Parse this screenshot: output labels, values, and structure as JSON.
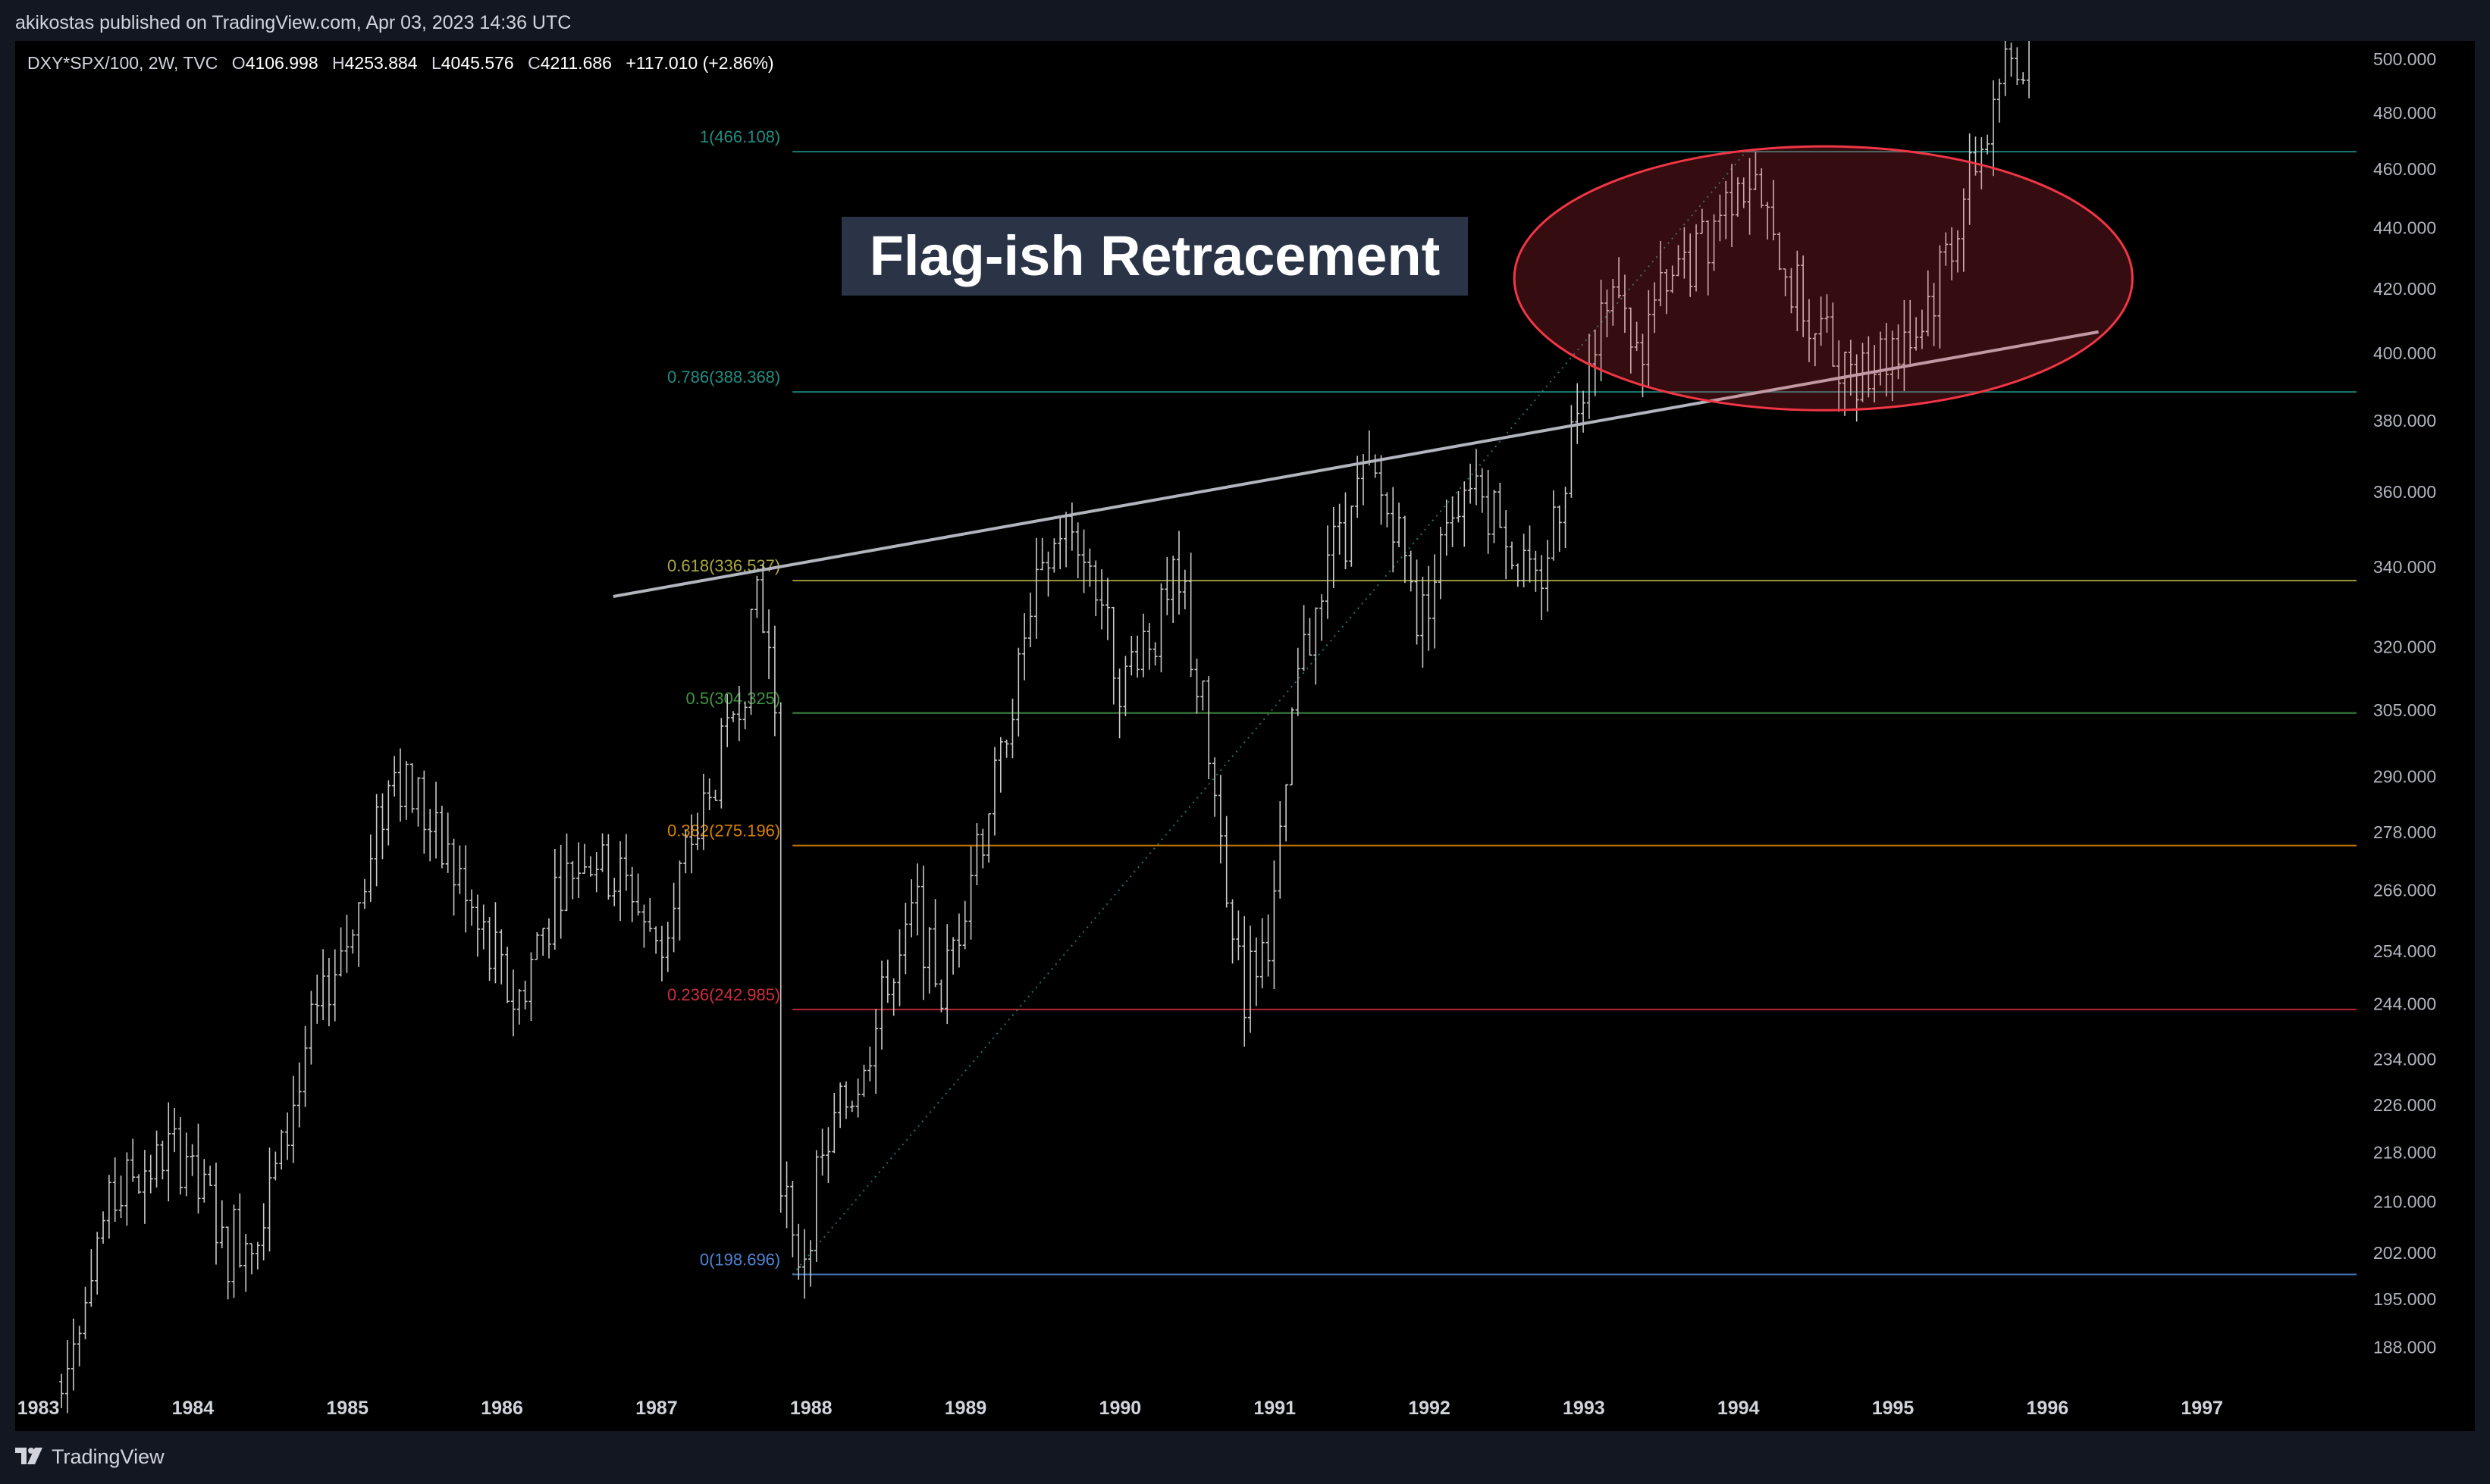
{
  "header": {
    "published_text": "akikostas published on TradingView.com, Apr 03, 2023 14:36 UTC"
  },
  "legend": {
    "symbol": "DXY*SPX/100, 2W, TVC",
    "open_label": "O",
    "open": "4106.998",
    "high_label": "H",
    "high": "4253.884",
    "low_label": "L",
    "low": "4045.576",
    "close_label": "C",
    "close": "4211.686",
    "change": "+117.010 (+2.86%)"
  },
  "annotation": {
    "text": "Flag-ish Retracement",
    "ellipse_color": "#f23645"
  },
  "footer": {
    "brand": "TradingView"
  },
  "chart_data": {
    "type": "ohlc",
    "interval": "2W",
    "y_scale": "log",
    "ylim": [
      182,
      507
    ],
    "xlim": [
      1982.85,
      1998.0
    ],
    "x_ticks": [
      "1983",
      "1984",
      "1985",
      "1986",
      "1987",
      "1988",
      "1989",
      "1990",
      "1991",
      "1992",
      "1993",
      "1994",
      "1995",
      "1996",
      "1997"
    ],
    "y_ticks": [
      "188.000",
      "195.000",
      "202.000",
      "210.000",
      "218.000",
      "226.000",
      "234.000",
      "244.000",
      "254.000",
      "266.000",
      "278.000",
      "290.000",
      "305.000",
      "320.000",
      "340.000",
      "360.000",
      "380.000",
      "400.000",
      "420.000",
      "440.000",
      "460.000",
      "480.000",
      "500.000"
    ],
    "price_path": [
      [
        1983.15,
        183
      ],
      [
        1983.3,
        197
      ],
      [
        1983.5,
        212
      ],
      [
        1983.75,
        216
      ],
      [
        1983.95,
        218
      ],
      [
        1984.2,
        203
      ],
      [
        1984.45,
        208
      ],
      [
        1984.7,
        232
      ],
      [
        1984.95,
        252
      ],
      [
        1985.15,
        272
      ],
      [
        1985.3,
        295
      ],
      [
        1985.5,
        282
      ],
      [
        1985.75,
        266
      ],
      [
        1985.95,
        252
      ],
      [
        1986.1,
        244
      ],
      [
        1986.3,
        262
      ],
      [
        1986.55,
        275
      ],
      [
        1986.8,
        268
      ],
      [
        1987.0,
        255
      ],
      [
        1987.2,
        272
      ],
      [
        1987.4,
        292
      ],
      [
        1987.55,
        310
      ],
      [
        1987.65,
        335
      ],
      [
        1987.72,
        320
      ],
      [
        1987.78,
        300
      ],
      [
        1987.8,
        218
      ],
      [
        1987.9,
        198.7
      ],
      [
        1988.1,
        218
      ],
      [
        1988.3,
        232
      ],
      [
        1988.5,
        248
      ],
      [
        1988.7,
        262
      ],
      [
        1988.85,
        244
      ],
      [
        1989.0,
        268
      ],
      [
        1989.2,
        290
      ],
      [
        1989.4,
        325
      ],
      [
        1989.6,
        350
      ],
      [
        1989.75,
        345
      ],
      [
        1989.9,
        330
      ],
      [
        1990.0,
        312
      ],
      [
        1990.15,
        322
      ],
      [
        1990.4,
        335
      ],
      [
        1990.55,
        300
      ],
      [
        1990.7,
        262
      ],
      [
        1990.8,
        248
      ],
      [
        1991.0,
        262
      ],
      [
        1991.15,
        312
      ],
      [
        1991.35,
        345
      ],
      [
        1991.6,
        362
      ],
      [
        1991.8,
        352
      ],
      [
        1991.95,
        325
      ],
      [
        1992.1,
        352
      ],
      [
        1992.3,
        365
      ],
      [
        1992.5,
        350
      ],
      [
        1992.7,
        330
      ],
      [
        1992.85,
        362
      ],
      [
        1993.0,
        395
      ],
      [
        1993.15,
        420
      ],
      [
        1993.35,
        402
      ],
      [
        1993.55,
        420
      ],
      [
        1993.8,
        438
      ],
      [
        1994.0,
        462
      ],
      [
        1994.15,
        445
      ],
      [
        1994.35,
        420
      ],
      [
        1994.55,
        405
      ],
      [
        1994.75,
        395
      ],
      [
        1994.95,
        402
      ],
      [
        1995.15,
        408
      ],
      [
        1995.3,
        425
      ],
      [
        1995.45,
        450
      ],
      [
        1995.6,
        472
      ],
      [
        1995.75,
        498
      ],
      [
        1995.9,
        504
      ]
    ],
    "fibonacci": [
      {
        "level": "1",
        "value": 466.108,
        "label": "1(466.108)",
        "color": "#26a69a"
      },
      {
        "level": "0.786",
        "value": 388.368,
        "label": "0.786(388.368)",
        "color": "#26a69a"
      },
      {
        "level": "0.618",
        "value": 336.537,
        "label": "0.618(336.537)",
        "color": "#c9c54a"
      },
      {
        "level": "0.5",
        "value": 304.325,
        "label": "0.5(304.325)",
        "color": "#4caf50"
      },
      {
        "level": "0.382",
        "value": 275.196,
        "label": "0.382(275.196)",
        "color": "#ff9800"
      },
      {
        "level": "0.236",
        "value": 242.985,
        "label": "0.236(242.985)",
        "color": "#f23645"
      },
      {
        "level": "0",
        "value": 198.696,
        "label": "0(198.696)",
        "color": "#5b9cf6"
      }
    ],
    "fib_start": {
      "x": 1987.88,
      "value": 198.696
    },
    "fib_end": {
      "x": 1994.05,
      "value": 466.108
    },
    "trendline": {
      "x1": 1986.72,
      "v1": 332.5,
      "x2": 1996.33,
      "v2": 406.5,
      "color": "#b2b5be"
    }
  }
}
